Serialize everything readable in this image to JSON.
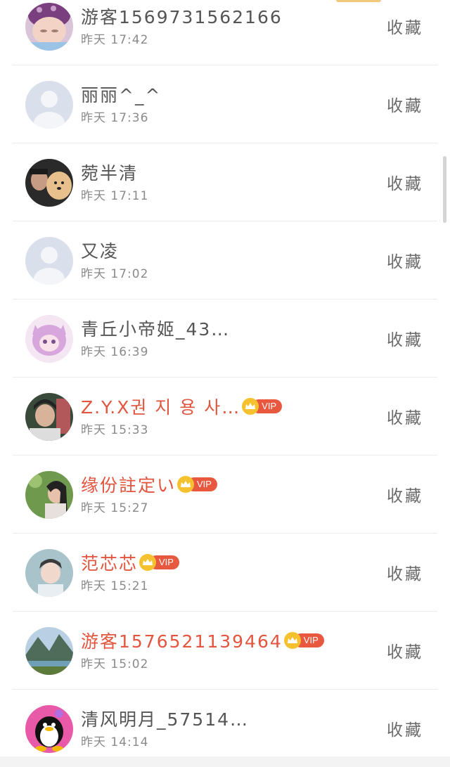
{
  "favorite_label": "收藏",
  "vip_label": "VIP",
  "rows": [
    {
      "name": "游客1569731562166",
      "time": "昨天 17:42",
      "vip": false
    },
    {
      "name": "丽丽^_^",
      "time": "昨天 17:36",
      "vip": false
    },
    {
      "name": "菀半清",
      "time": "昨天 17:11",
      "vip": false
    },
    {
      "name": "又凌",
      "time": "昨天 17:02",
      "vip": false
    },
    {
      "name": "青丘小帝姬_43…",
      "time": "昨天 16:39",
      "vip": false
    },
    {
      "name": "Z.Y.X권 지 용 사…",
      "time": "昨天 15:33",
      "vip": true
    },
    {
      "name": "缘份註定い",
      "time": "昨天 15:27",
      "vip": true
    },
    {
      "name": "范芯芯",
      "time": "昨天 15:21",
      "vip": true
    },
    {
      "name": "游客1576521139464",
      "time": "昨天 15:02",
      "vip": true
    },
    {
      "name": "清风明月_57514…",
      "time": "昨天 14:14",
      "vip": false
    }
  ],
  "colors": {
    "vip_name": "#e2553e",
    "normal_name": "#555555",
    "vip_badge": "#e8583f",
    "crown": "#f6c12e"
  },
  "avatars": [
    "baby-photo-avatar",
    "default-person-avatar",
    "man-with-dog-avatar",
    "default-person-avatar",
    "anime-fox-girl-avatar",
    "person-photo-avatar",
    "woman-photo-avatar",
    "child-photo-avatar",
    "landscape-mountain-avatar",
    "penguin-avatar"
  ]
}
